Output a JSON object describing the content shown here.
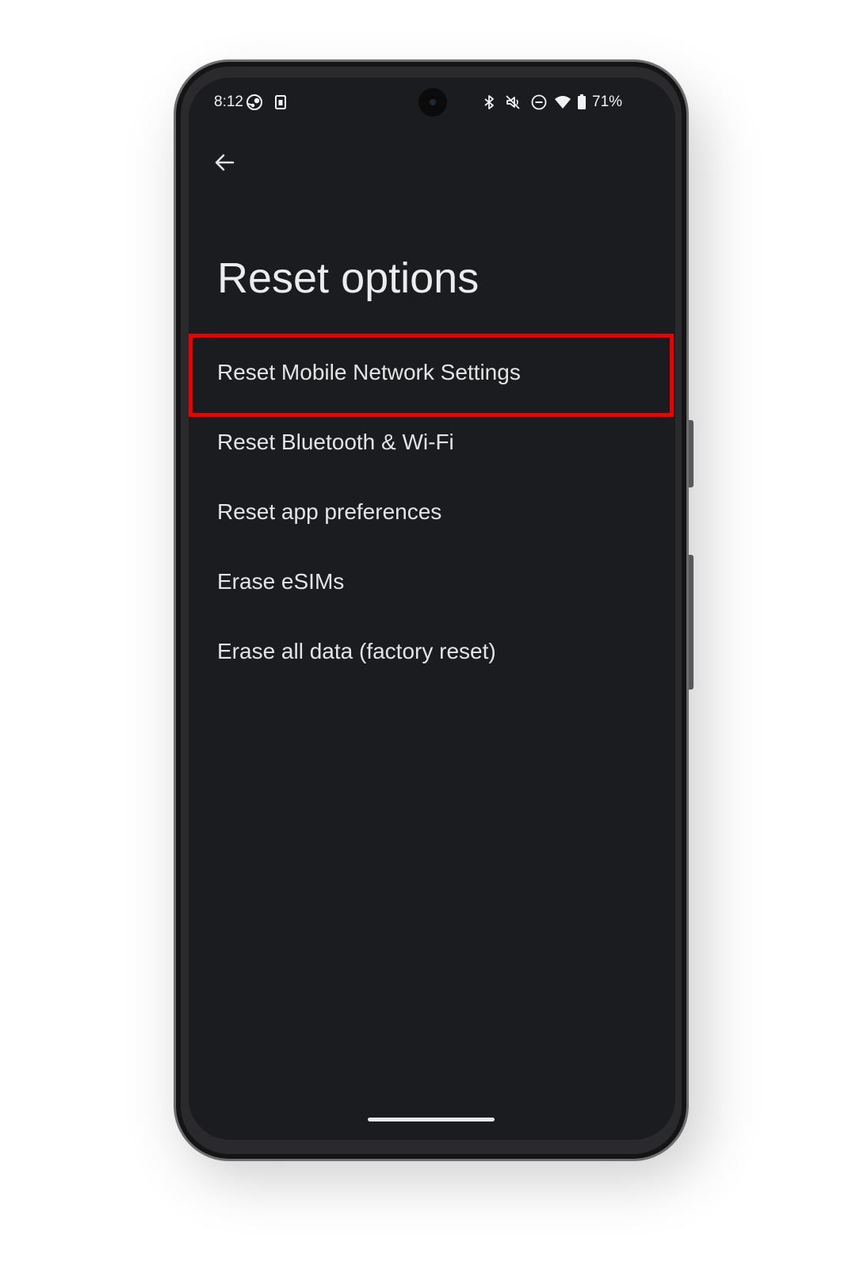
{
  "status_bar": {
    "time": "8:12",
    "left_icons": [
      "steam-notification-icon",
      "sim-card-icon"
    ],
    "right_icons": [
      "bluetooth-icon",
      "vibrate-off-icon",
      "do-not-disturb-icon",
      "wifi-icon",
      "battery-icon"
    ],
    "battery_percent": "71%"
  },
  "page": {
    "title": "Reset options"
  },
  "options": [
    {
      "label": "Reset Mobile Network Settings",
      "highlighted": true
    },
    {
      "label": "Reset Bluetooth & Wi-Fi",
      "highlighted": false
    },
    {
      "label": "Reset app preferences",
      "highlighted": false
    },
    {
      "label": "Erase eSIMs",
      "highlighted": false
    },
    {
      "label": "Erase all data (factory reset)",
      "highlighted": false
    }
  ],
  "colors": {
    "screen_background": "#1b1c20",
    "text": "#e4e4e4",
    "highlight": "#ee0000",
    "phone_frame": "#2a2a2c"
  }
}
